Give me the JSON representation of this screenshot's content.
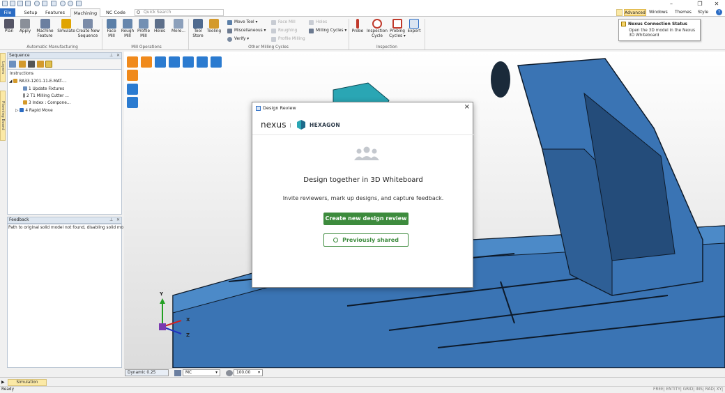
{
  "window": {
    "minimize": "–",
    "restore": "❐",
    "close": "✕"
  },
  "menu_tabs": [
    {
      "label": "File"
    },
    {
      "label": "Setup"
    },
    {
      "label": "Features"
    },
    {
      "label": "Machining"
    },
    {
      "label": "NC Code"
    }
  ],
  "quick_search": {
    "placeholder": "Quick Search"
  },
  "right_menu": {
    "advanced": "Advanced",
    "windows": "Windows",
    "themes": "Themes",
    "style": "Style",
    "help": "?"
  },
  "ribbon": {
    "automatic": {
      "plan": "Plan",
      "apply": "Apply",
      "machine_feature": "Machine Feature",
      "simulate": "Simulate",
      "create_new_sequence": "Create New Sequence",
      "group": "Automatic Manufacturing"
    },
    "mill_ops": {
      "face_mill": "Face Mill",
      "rough_mill": "Rough Mill",
      "profile_mill": "Profile Mill",
      "holes": "Holes",
      "more": "More...",
      "group": "Mill Operations"
    },
    "other": {
      "tool_store": "Tool Store",
      "tooling": "Tooling",
      "move_tool": "Move Tool",
      "miscellaneous": "Miscellaneous",
      "verify": "Verify",
      "face_mill": "Face Mill",
      "roughing": "Roughing",
      "profile_milling": "Profile Milling",
      "holes": "Holes",
      "milling_cycles": "Milling Cycles",
      "group": "Other Milling Cycles"
    },
    "inspection": {
      "probe": "Probe",
      "inspection_cycle": "Inspection Cycle",
      "probing_cycles": "Probing Cycles",
      "export": "Export",
      "group": "Inspection"
    }
  },
  "tooltip": {
    "title": "Nexus Connection Status",
    "text": "Open the 3D model in the Nexus 3D Whiteboard"
  },
  "side_tabs": {
    "layers": "Layers",
    "planning_board": "Planning Board"
  },
  "sequence": {
    "title": "Sequence",
    "header": "Instructions",
    "nodes": [
      {
        "label": "RA33-1201-11-E-MAT-..."
      },
      {
        "label": "1 Update Fixtures"
      },
      {
        "label": "2 T1 Milling Cutter ..."
      },
      {
        "label": "3 Index : Compone..."
      },
      {
        "label": "4 Rapid Move"
      }
    ]
  },
  "feedback": {
    "title": "Feedback",
    "message": "Path to original solid model not found, disabling solid mo"
  },
  "axes": {
    "y": "Y",
    "x": "X",
    "z": "Z"
  },
  "dialog": {
    "title": "Design Review",
    "brand_nexus": "nexus",
    "brand_hexagon": "HEXAGON",
    "heading": "Design together in 3D Whiteboard",
    "text": "Invite reviewers, mark up designs, and capture feedback.",
    "create_button": "Create new design review",
    "previous_button": "Previously shared"
  },
  "viewport_bar": {
    "mode": "Dynamic 0.25",
    "mc": "MC",
    "zoom": "100.00"
  },
  "simulation_tab": "Simulation",
  "status": {
    "ready": "Ready",
    "flags": "FREE| ENTITY| GRID| INS| RAD| XY| MM"
  },
  "colors": {
    "accent": "#2b6cc4",
    "green": "#3d8b3d",
    "model_blue": "#3a74b4",
    "advanced_bg": "#fde39a"
  }
}
